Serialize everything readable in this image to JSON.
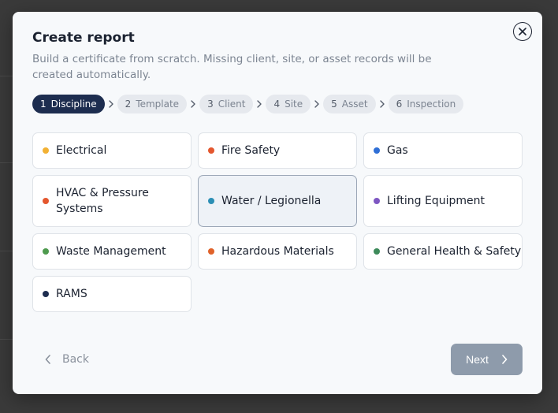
{
  "modal": {
    "title": "Create report",
    "subtitle": "Build a certificate from scratch. Missing client, site, or asset records will be created automatically.",
    "close_icon": "close-icon"
  },
  "steps": [
    {
      "num": "1",
      "label": "Discipline",
      "active": true
    },
    {
      "num": "2",
      "label": "Template",
      "active": false
    },
    {
      "num": "3",
      "label": "Client",
      "active": false
    },
    {
      "num": "4",
      "label": "Site",
      "active": false
    },
    {
      "num": "5",
      "label": "Asset",
      "active": false
    },
    {
      "num": "6",
      "label": "Inspection",
      "active": false
    }
  ],
  "disciplines": [
    {
      "label": "Electrical",
      "color": "#f2b134",
      "selected": false
    },
    {
      "label": "Fire Safety",
      "color": "#e4572e",
      "selected": false
    },
    {
      "label": "Gas",
      "color": "#2f6fd6",
      "selected": false
    },
    {
      "label": "HVAC & Pressure Systems",
      "color": "#e4572e",
      "selected": false
    },
    {
      "label": "Water / Legionella",
      "color": "#2c8fb5",
      "selected": true
    },
    {
      "label": "Lifting Equipment",
      "color": "#7e57c2",
      "selected": false
    },
    {
      "label": "Waste Management",
      "color": "#4e9a4e",
      "selected": false
    },
    {
      "label": "Hazardous Materials",
      "color": "#e0622a",
      "selected": false
    },
    {
      "label": "General Health & Safety",
      "color": "#3d8a5a",
      "selected": false
    },
    {
      "label": "RAMS",
      "color": "#1d2d4f",
      "selected": false
    }
  ],
  "footer": {
    "back_label": "Back",
    "next_label": "Next"
  }
}
